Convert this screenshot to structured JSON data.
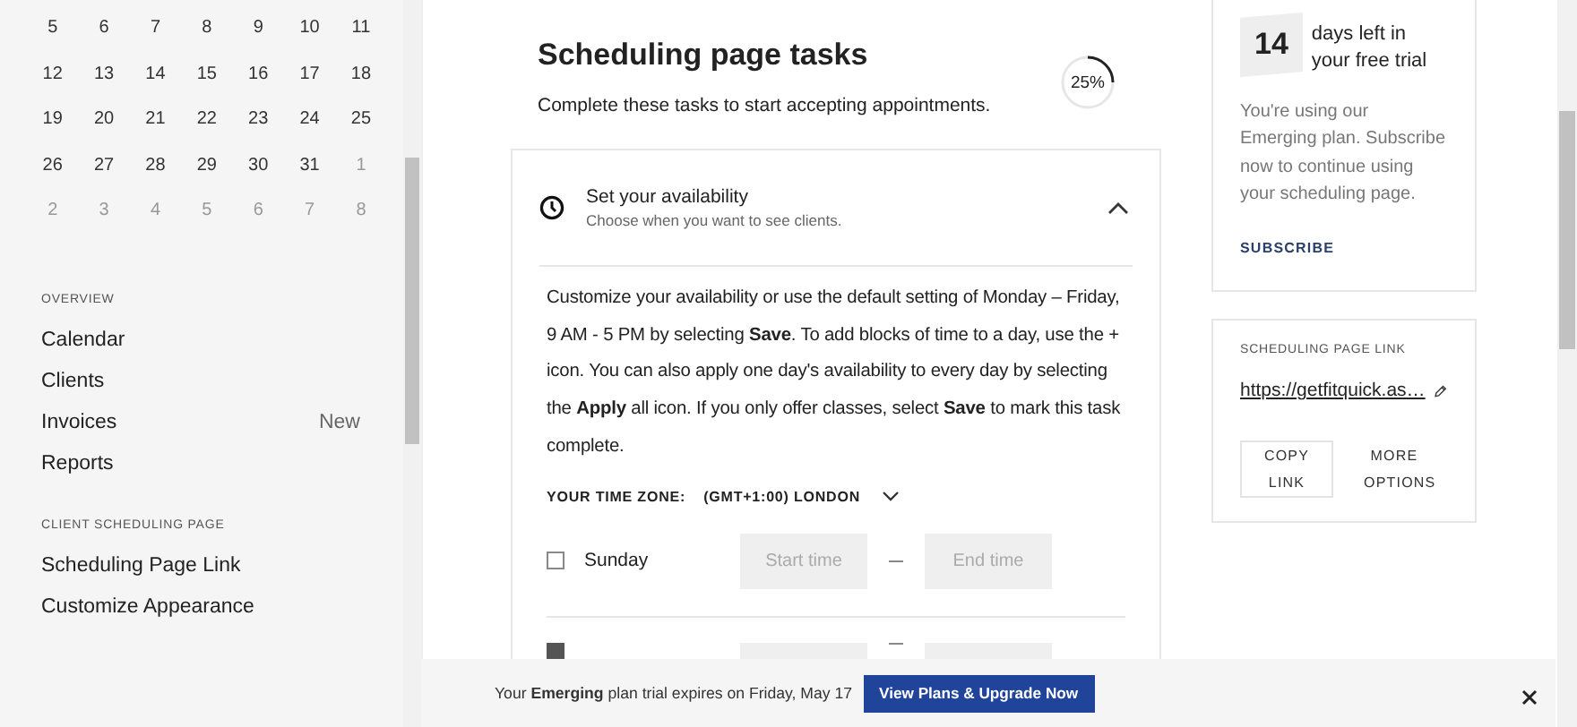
{
  "calendar": {
    "weeks": [
      [
        {
          "day": "5",
          "muted": false
        },
        {
          "day": "6",
          "muted": false
        },
        {
          "day": "7",
          "muted": false
        },
        {
          "day": "8",
          "muted": false
        },
        {
          "day": "9",
          "muted": false
        },
        {
          "day": "10",
          "muted": false
        },
        {
          "day": "11",
          "muted": false
        }
      ],
      [
        {
          "day": "12",
          "muted": false
        },
        {
          "day": "13",
          "muted": false
        },
        {
          "day": "14",
          "muted": false
        },
        {
          "day": "15",
          "muted": false
        },
        {
          "day": "16",
          "muted": false
        },
        {
          "day": "17",
          "muted": false
        },
        {
          "day": "18",
          "muted": false
        }
      ],
      [
        {
          "day": "19",
          "muted": false
        },
        {
          "day": "20",
          "muted": false
        },
        {
          "day": "21",
          "muted": false
        },
        {
          "day": "22",
          "muted": false
        },
        {
          "day": "23",
          "muted": false
        },
        {
          "day": "24",
          "muted": false
        },
        {
          "day": "25",
          "muted": false
        }
      ],
      [
        {
          "day": "26",
          "muted": false
        },
        {
          "day": "27",
          "muted": false
        },
        {
          "day": "28",
          "muted": false
        },
        {
          "day": "29",
          "muted": false
        },
        {
          "day": "30",
          "muted": false
        },
        {
          "day": "31",
          "muted": false
        },
        {
          "day": "1",
          "muted": true
        }
      ],
      [
        {
          "day": "2",
          "muted": true
        },
        {
          "day": "3",
          "muted": true
        },
        {
          "day": "4",
          "muted": true
        },
        {
          "day": "5",
          "muted": true
        },
        {
          "day": "6",
          "muted": true
        },
        {
          "day": "7",
          "muted": true
        },
        {
          "day": "8",
          "muted": true
        }
      ]
    ]
  },
  "sidebar": {
    "sections": [
      {
        "heading": "OVERVIEW",
        "items": [
          {
            "label": "Calendar"
          },
          {
            "label": "Clients"
          },
          {
            "label": "Invoices",
            "badge": "New"
          },
          {
            "label": "Reports"
          }
        ]
      },
      {
        "heading": "CLIENT SCHEDULING PAGE",
        "items": [
          {
            "label": "Scheduling Page Link"
          },
          {
            "label": "Customize Appearance"
          }
        ]
      }
    ]
  },
  "tasks": {
    "title": "Scheduling page tasks",
    "subtitle": "Complete these tasks to start accepting appointments.",
    "progress": {
      "level": 0.25,
      "label": "25%"
    },
    "task": {
      "title": "Set your availability",
      "subtitle": "Choose when you want to see clients.",
      "expanded": true,
      "description": "Customize your availability or use the default setting of Monday – Friday, 9 AM - 5 PM by selecting **Save**. To add blocks of time to a day, use the + icon. You can also apply one day's availability to every day by selecting the **Apply** all icon. If you only offer classes, select **Save** to mark this task complete.",
      "timezone": {
        "label": "YOUR TIME ZONE:",
        "value": "(GMT+1:00) LONDON"
      },
      "days": [
        {
          "name": "Sunday",
          "checked": false,
          "start_placeholder": "Start time",
          "end_placeholder": "End time"
        },
        {
          "checked": true
        }
      ]
    }
  },
  "trial": {
    "days": "14",
    "headline": "days left in your free trial",
    "body": "You're using our Emerging plan. Subscribe now to continue using your scheduling page.",
    "link": "SUBSCRIBE"
  },
  "link_card": {
    "heading": "SCHEDULING PAGE LINK",
    "url": "https://getfitquick.as…",
    "buttons": [
      "COPY LINK",
      "MORE OPTIONS"
    ]
  },
  "banner": {
    "text": "Your **Emerging** plan trial expires on Friday, May 17",
    "button": "View Plans & Upgrade Now"
  }
}
